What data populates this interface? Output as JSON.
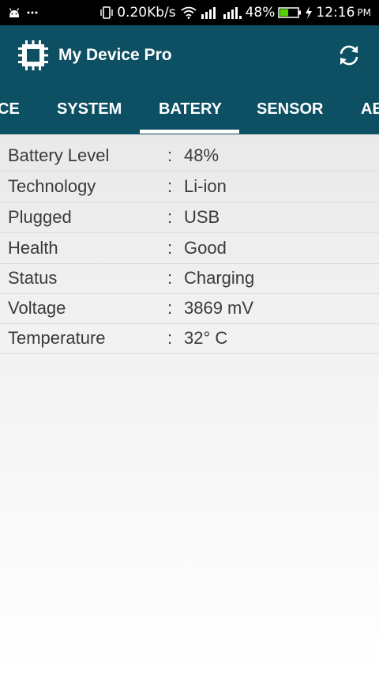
{
  "status_bar": {
    "speed": "0.20Kb/s",
    "battery_percent": "48%",
    "time": "12:16",
    "ampm": "PM",
    "icons": [
      "android-icon",
      "more-dots-icon",
      "vibrate-icon",
      "wifi-icon",
      "signal-icon",
      "signal-icon",
      "battery-icon",
      "charging-bolt-icon"
    ]
  },
  "app": {
    "title": "My Device Pro",
    "logo_icon": "chip-icon",
    "refresh_icon": "refresh-icon"
  },
  "tabs": [
    {
      "label": "CE"
    },
    {
      "label": "SYSTEM"
    },
    {
      "label": "BATERY",
      "active": true
    },
    {
      "label": "SENSOR"
    },
    {
      "label": "AE"
    }
  ],
  "colors": {
    "primary": "#0d4f63",
    "battery_fill": "#55d400"
  },
  "battery_info": [
    {
      "label": "Battery Level",
      "sep": ":",
      "value": "48%"
    },
    {
      "label": "Technology",
      "sep": ":",
      "value": "Li-ion"
    },
    {
      "label": "Plugged",
      "sep": ":",
      "value": "USB"
    },
    {
      "label": "Health",
      "sep": ":",
      "value": "Good"
    },
    {
      "label": "Status",
      "sep": ":",
      "value": "Charging"
    },
    {
      "label": "Voltage",
      "sep": ":",
      "value": "3869 mV"
    },
    {
      "label": "Temperature",
      "sep": ":",
      "value": "32° C"
    }
  ]
}
